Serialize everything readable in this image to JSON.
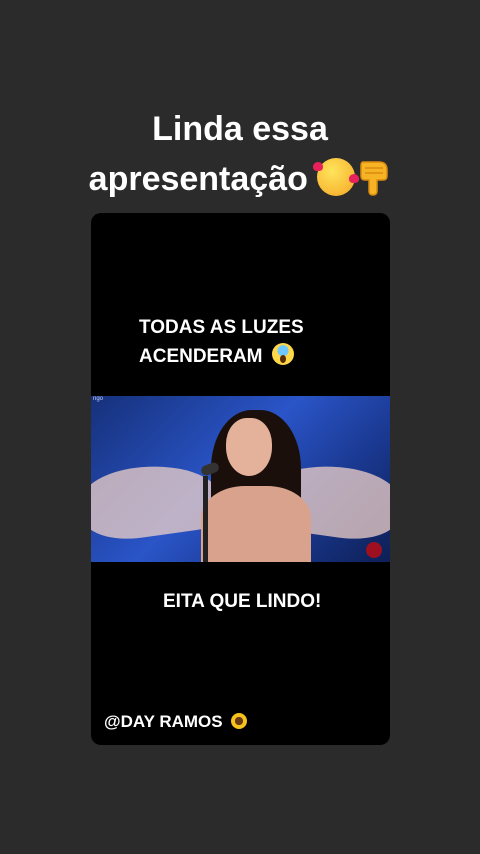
{
  "caption": {
    "line1": "Linda essa",
    "line2": "apresentação",
    "emoji_1": "smiling-face-with-hearts-icon",
    "emoji_2": "backhand-index-pointing-down-icon"
  },
  "video": {
    "top_text_line1": "TODAS AS LUZES",
    "top_text_line2": "ACENDERAM",
    "top_text_emoji": "face-screaming-in-fear-icon",
    "middle_text": "EITA QUE LINDO!",
    "handle": "@DAY RAMOS",
    "handle_emoji": "sunflower-icon",
    "watermark": "ngo"
  }
}
